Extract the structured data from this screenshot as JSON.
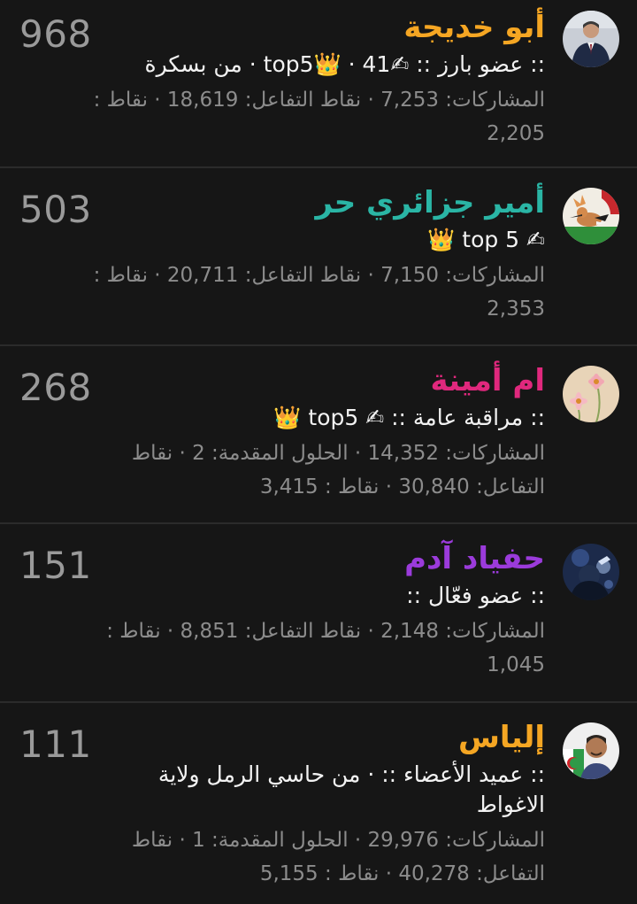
{
  "members": [
    {
      "name": "أبو خديجة",
      "name_color": "#f5a623",
      "count": "968",
      "title": ":: عضو بارز :: ✍top5👑 · 41 · من بسكرة",
      "stats": "المشاركات: 7,253 · نقاط التفاعل: 18,619 · نقاط : 2,205",
      "avatar": "man-in-suit-avatar"
    },
    {
      "name": "أمير جزائري حر",
      "name_color": "#2ab5a5",
      "count": "503",
      "title": "✍ top 5 👑",
      "stats": "المشاركات: 7,150 · نقاط التفاعل: 20,711 · نقاط : 2,353",
      "avatar": "hoopoe-bird-avatar"
    },
    {
      "name": "ام أمينة",
      "name_color": "#e0287d",
      "count": "268",
      "title": ":: مراقبة عامة :: ✍ top5 👑",
      "stats": "المشاركات: 14,352 · الحلول المقدمة: 2 · نقاط التفاعل: 30,840 · نقاط : 3,415",
      "avatar": "pink-flowers-avatar"
    },
    {
      "name": "حفياد آدم",
      "name_color": "#9b3bdb",
      "count": "151",
      "title": ":: عضو فعّال ::",
      "stats": "المشاركات: 2,148 · نقاط التفاعل: 8,851 · نقاط : 1,045",
      "avatar": "dark-portrait-avatar"
    },
    {
      "name": "إلياس",
      "name_color": "#f5a623",
      "count": "111",
      "title": ":: عميد الأعضاء :: · من حاسي الرمل ولاية الاغواط",
      "stats": "المشاركات: 29,976 · الحلول المقدمة: 1 · نقاط التفاعل: 40,278 · نقاط : 5,155",
      "avatar": "man-with-flag-avatar"
    }
  ]
}
